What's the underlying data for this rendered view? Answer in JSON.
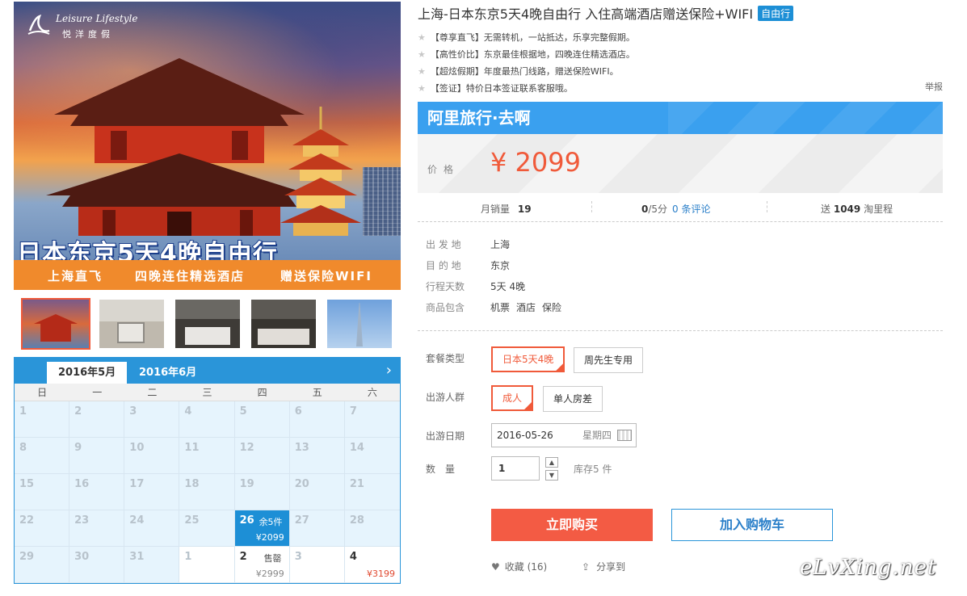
{
  "hero": {
    "logo_en": "Leisure Lifestyle",
    "logo_cn": "悦洋度假",
    "title": "日本东京5天4晚自由行",
    "band": [
      "上海直飞",
      "四晚连住精选酒店",
      "赠送保险WIFI"
    ]
  },
  "calendar": {
    "tab_active": "2016年5月",
    "tab_other": "2016年6月",
    "weekdays": [
      "日",
      "一",
      "二",
      "三",
      "四",
      "五",
      "六"
    ],
    "cells": [
      {
        "d": "1"
      },
      {
        "d": "2"
      },
      {
        "d": "3"
      },
      {
        "d": "4"
      },
      {
        "d": "5"
      },
      {
        "d": "6"
      },
      {
        "d": "7"
      },
      {
        "d": "8"
      },
      {
        "d": "9"
      },
      {
        "d": "10"
      },
      {
        "d": "11"
      },
      {
        "d": "12"
      },
      {
        "d": "13"
      },
      {
        "d": "14"
      },
      {
        "d": "15"
      },
      {
        "d": "16"
      },
      {
        "d": "17"
      },
      {
        "d": "18"
      },
      {
        "d": "19"
      },
      {
        "d": "20"
      },
      {
        "d": "21"
      },
      {
        "d": "22"
      },
      {
        "d": "23"
      },
      {
        "d": "24"
      },
      {
        "d": "25"
      },
      {
        "d": "26",
        "tag": "余5件",
        "price": "¥2099",
        "state": "selected"
      },
      {
        "d": "27"
      },
      {
        "d": "28"
      },
      {
        "d": "29"
      },
      {
        "d": "30"
      },
      {
        "d": "31"
      },
      {
        "d": "1",
        "state": "next"
      },
      {
        "d": "2",
        "tag": "售罄",
        "price": "¥2999",
        "state": "plain"
      },
      {
        "d": "3",
        "state": "next"
      },
      {
        "d": "4",
        "price": "¥3199",
        "state": "plain-red"
      }
    ]
  },
  "product": {
    "title": "上海-日本东京5天4晚自由行 入住高端酒店赠送保险+WIFI",
    "badge": "自由行",
    "features": [
      "【尊享直飞】无需转机，一站抵达，乐享完整假期。",
      "【高性价比】东京最佳根据地，四晚连住精选酒店。",
      "【超炫假期】年度最热门线路，赠送保险WIFI。",
      "【签证】特价日本签证联系客服哦。"
    ],
    "report": "举报"
  },
  "ali": {
    "brand": "阿里旅行·去啊",
    "price_label": "价格",
    "price": "¥ 2099"
  },
  "stats": {
    "monthly_label": "月销量",
    "monthly_value": "19",
    "rating_value": "0",
    "rating_suffix": "/5分",
    "reviews": "0 条评论",
    "gift_prefix": "送",
    "gift_value": "1049",
    "gift_suffix": "淘里程"
  },
  "info": [
    {
      "k": "出 发 地",
      "v": "上海"
    },
    {
      "k": "目 的 地",
      "v": "东京"
    },
    {
      "k": "行程天数",
      "v": "5天 4晚"
    },
    {
      "k": "商品包含",
      "items": [
        "机票",
        "酒店",
        "保险"
      ]
    }
  ],
  "options": {
    "package_label": "套餐类型",
    "package": [
      "日本5天4晚",
      "周先生专用"
    ],
    "people_label": "出游人群",
    "people": [
      "成人",
      "单人房差"
    ],
    "date_label": "出游日期",
    "date_value": "2016-05-26",
    "date_weekday": "星期四",
    "qty_label": "数　量",
    "qty_value": "1",
    "stock": "库存5 件"
  },
  "actions": {
    "buy": "立即购买",
    "cart": "加入购物车",
    "fav": "收藏 (16)",
    "share": "分享到"
  },
  "watermark": "eLvXing.net",
  "colors": {
    "accent": "#2a95d9",
    "price": "#f05a3a",
    "buy": "#f35b44"
  }
}
